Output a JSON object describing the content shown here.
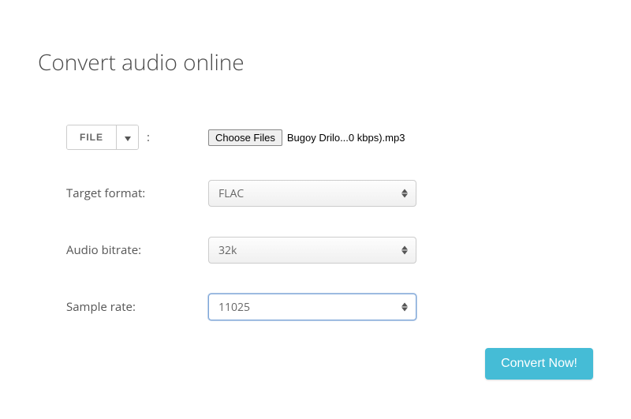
{
  "title": "Convert audio online",
  "file_source": {
    "button_label": "FILE",
    "colon": ":"
  },
  "file_input": {
    "choose_label": "Choose Files",
    "selected_filename": "Bugoy Drilo...0 kbps).mp3"
  },
  "fields": {
    "target_format": {
      "label": "Target format:",
      "value": "FLAC"
    },
    "audio_bitrate": {
      "label": "Audio bitrate:",
      "value": "32k"
    },
    "sample_rate": {
      "label": "Sample rate:",
      "value": "11025"
    }
  },
  "submit_label": "Convert Now!"
}
